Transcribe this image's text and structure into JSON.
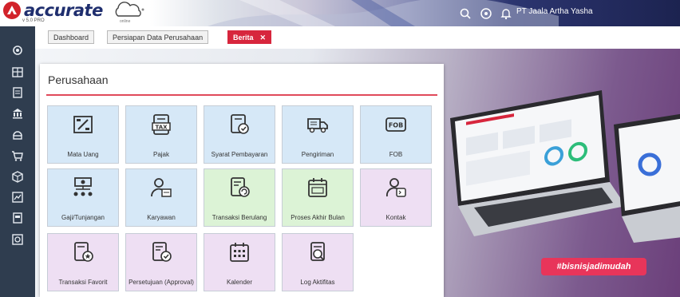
{
  "app": {
    "logo_text": "accurate",
    "logo_version": "v 5.0 PRO",
    "cloud_sub": "online",
    "company": "PT Jaala Artha Yasha"
  },
  "header_icons": [
    "search-icon",
    "help-icon",
    "bell-icon"
  ],
  "sidebar": {
    "items": [
      {
        "name": "settings-icon"
      },
      {
        "name": "company-icon"
      },
      {
        "name": "ledger-icon"
      },
      {
        "name": "bank-icon"
      },
      {
        "name": "sales-icon"
      },
      {
        "name": "purchase-icon"
      },
      {
        "name": "inventory-icon"
      },
      {
        "name": "report-icon"
      },
      {
        "name": "document-icon"
      },
      {
        "name": "tools-icon"
      }
    ]
  },
  "tabs": [
    {
      "label": "Dashboard"
    },
    {
      "label": "Persiapan Data Perusahaan"
    },
    {
      "label": "Berita",
      "close": "✕"
    }
  ],
  "panel": {
    "title": "Perusahaan",
    "tiles": [
      {
        "label": "Mata Uang",
        "icon": "currency-icon",
        "color": "blue"
      },
      {
        "label": "Pajak",
        "icon": "tax-icon",
        "color": "blue"
      },
      {
        "label": "Syarat Pembayaran",
        "icon": "payment-terms-icon",
        "color": "blue"
      },
      {
        "label": "Pengiriman",
        "icon": "shipping-icon",
        "color": "blue"
      },
      {
        "label": "FOB",
        "icon": "fob-icon",
        "color": "blue"
      },
      {
        "label": "Gaji/Tunjangan",
        "icon": "salary-icon",
        "color": "blue"
      },
      {
        "label": "Karyawan",
        "icon": "employee-icon",
        "color": "blue"
      },
      {
        "label": "Transaksi Berulang",
        "icon": "recurring-transaction-icon",
        "color": "green"
      },
      {
        "label": "Proses Akhir Bulan",
        "icon": "month-end-icon",
        "color": "green"
      },
      {
        "label": "Kontak",
        "icon": "contact-icon",
        "color": "purple"
      },
      {
        "label": "Transaksi Favorit",
        "icon": "favorite-transaction-icon",
        "color": "purple"
      },
      {
        "label": "Persetujuan (Approval)",
        "icon": "approval-icon",
        "color": "purple"
      },
      {
        "label": "Kalender",
        "icon": "calendar-icon",
        "color": "purple"
      },
      {
        "label": "Log Aktifitas",
        "icon": "activity-log-icon",
        "color": "purple"
      }
    ]
  },
  "banner": {
    "hashtag": "#bisnisjadimudah"
  },
  "colors": {
    "accent": "#d7263d",
    "sidebar": "#2f3d4f",
    "brand": "#1f2e6e"
  }
}
